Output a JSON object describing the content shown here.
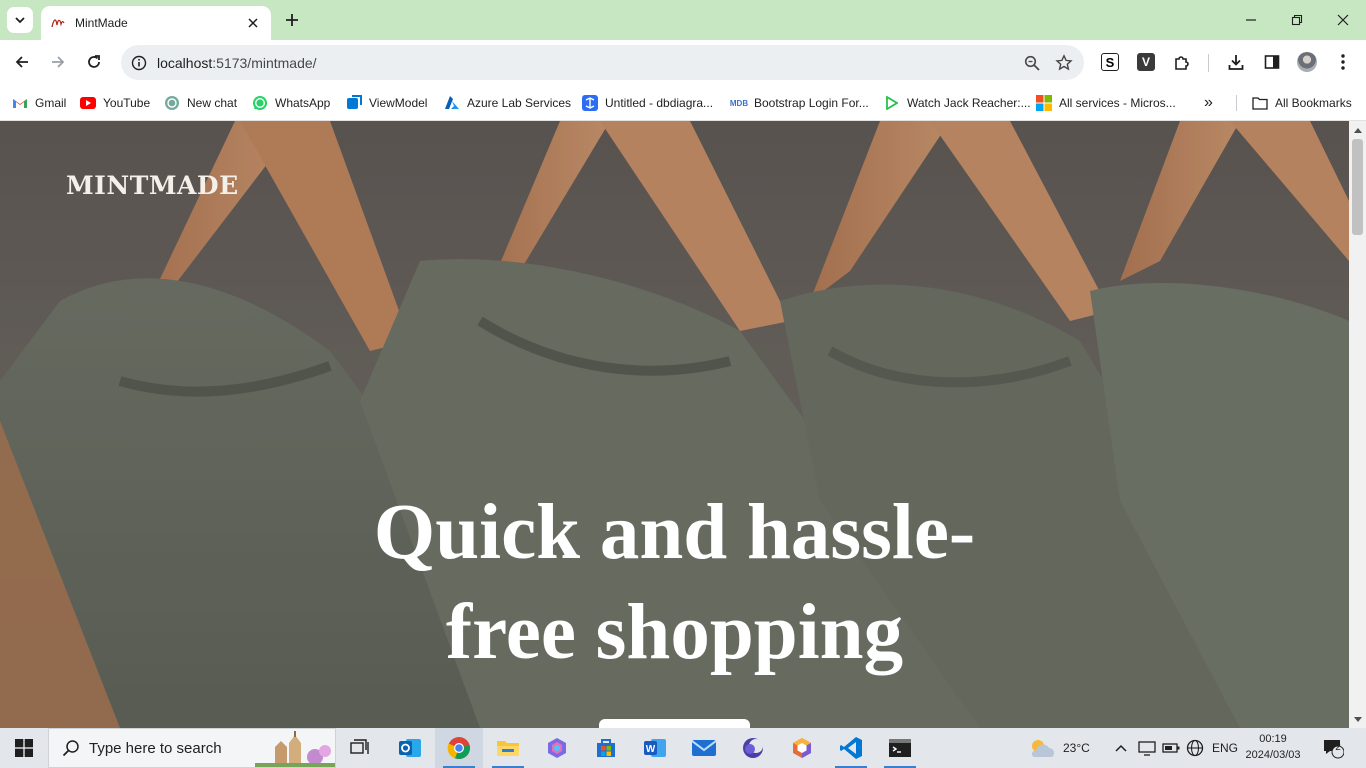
{
  "browser": {
    "tab_title": "MintMade",
    "url_host": "localhost",
    "url_path": ":5173/mintmade/",
    "icons": [
      "tab-search-icon",
      "close-icon",
      "plus-icon",
      "minimize-icon",
      "restore-icon",
      "close-window-icon",
      "back-icon",
      "forward-icon",
      "reload-icon",
      "info-icon",
      "zoom-icon",
      "star-icon",
      "download-icon",
      "side-panel-icon",
      "menu-icon"
    ]
  },
  "extensions": [
    "S",
    "V"
  ],
  "bookmarks": [
    {
      "label": "Gmail",
      "icon": "gmail-icon"
    },
    {
      "label": "YouTube",
      "icon": "youtube-icon"
    },
    {
      "label": "New chat",
      "icon": "chatgpt-icon"
    },
    {
      "label": "WhatsApp",
      "icon": "whatsapp-icon"
    },
    {
      "label": "ViewModel",
      "icon": "viewmodel-icon"
    },
    {
      "label": "Azure Lab Services",
      "icon": "azure-icon"
    },
    {
      "label": "Untitled - dbdiagra...",
      "icon": "dbdiagram-icon"
    },
    {
      "label": "Bootstrap Login For...",
      "icon": "mdb-icon"
    },
    {
      "label": "Watch Jack Reacher:...",
      "icon": "play-icon"
    },
    {
      "label": "All services - Micros...",
      "icon": "microsoft-icon"
    }
  ],
  "bookmarks_more": "»",
  "all_bookmarks": "All Bookmarks",
  "mdb_badge": "MDB",
  "page": {
    "brand": "MINTMADE",
    "headline": "Quick and hassle-free shopping"
  },
  "taskbar": {
    "search_placeholder": "Type here to search",
    "weather": "23°C",
    "language": "ENG",
    "time": "00:19",
    "date": "2024/03/03",
    "notifications": "2",
    "word_letter": "W"
  }
}
